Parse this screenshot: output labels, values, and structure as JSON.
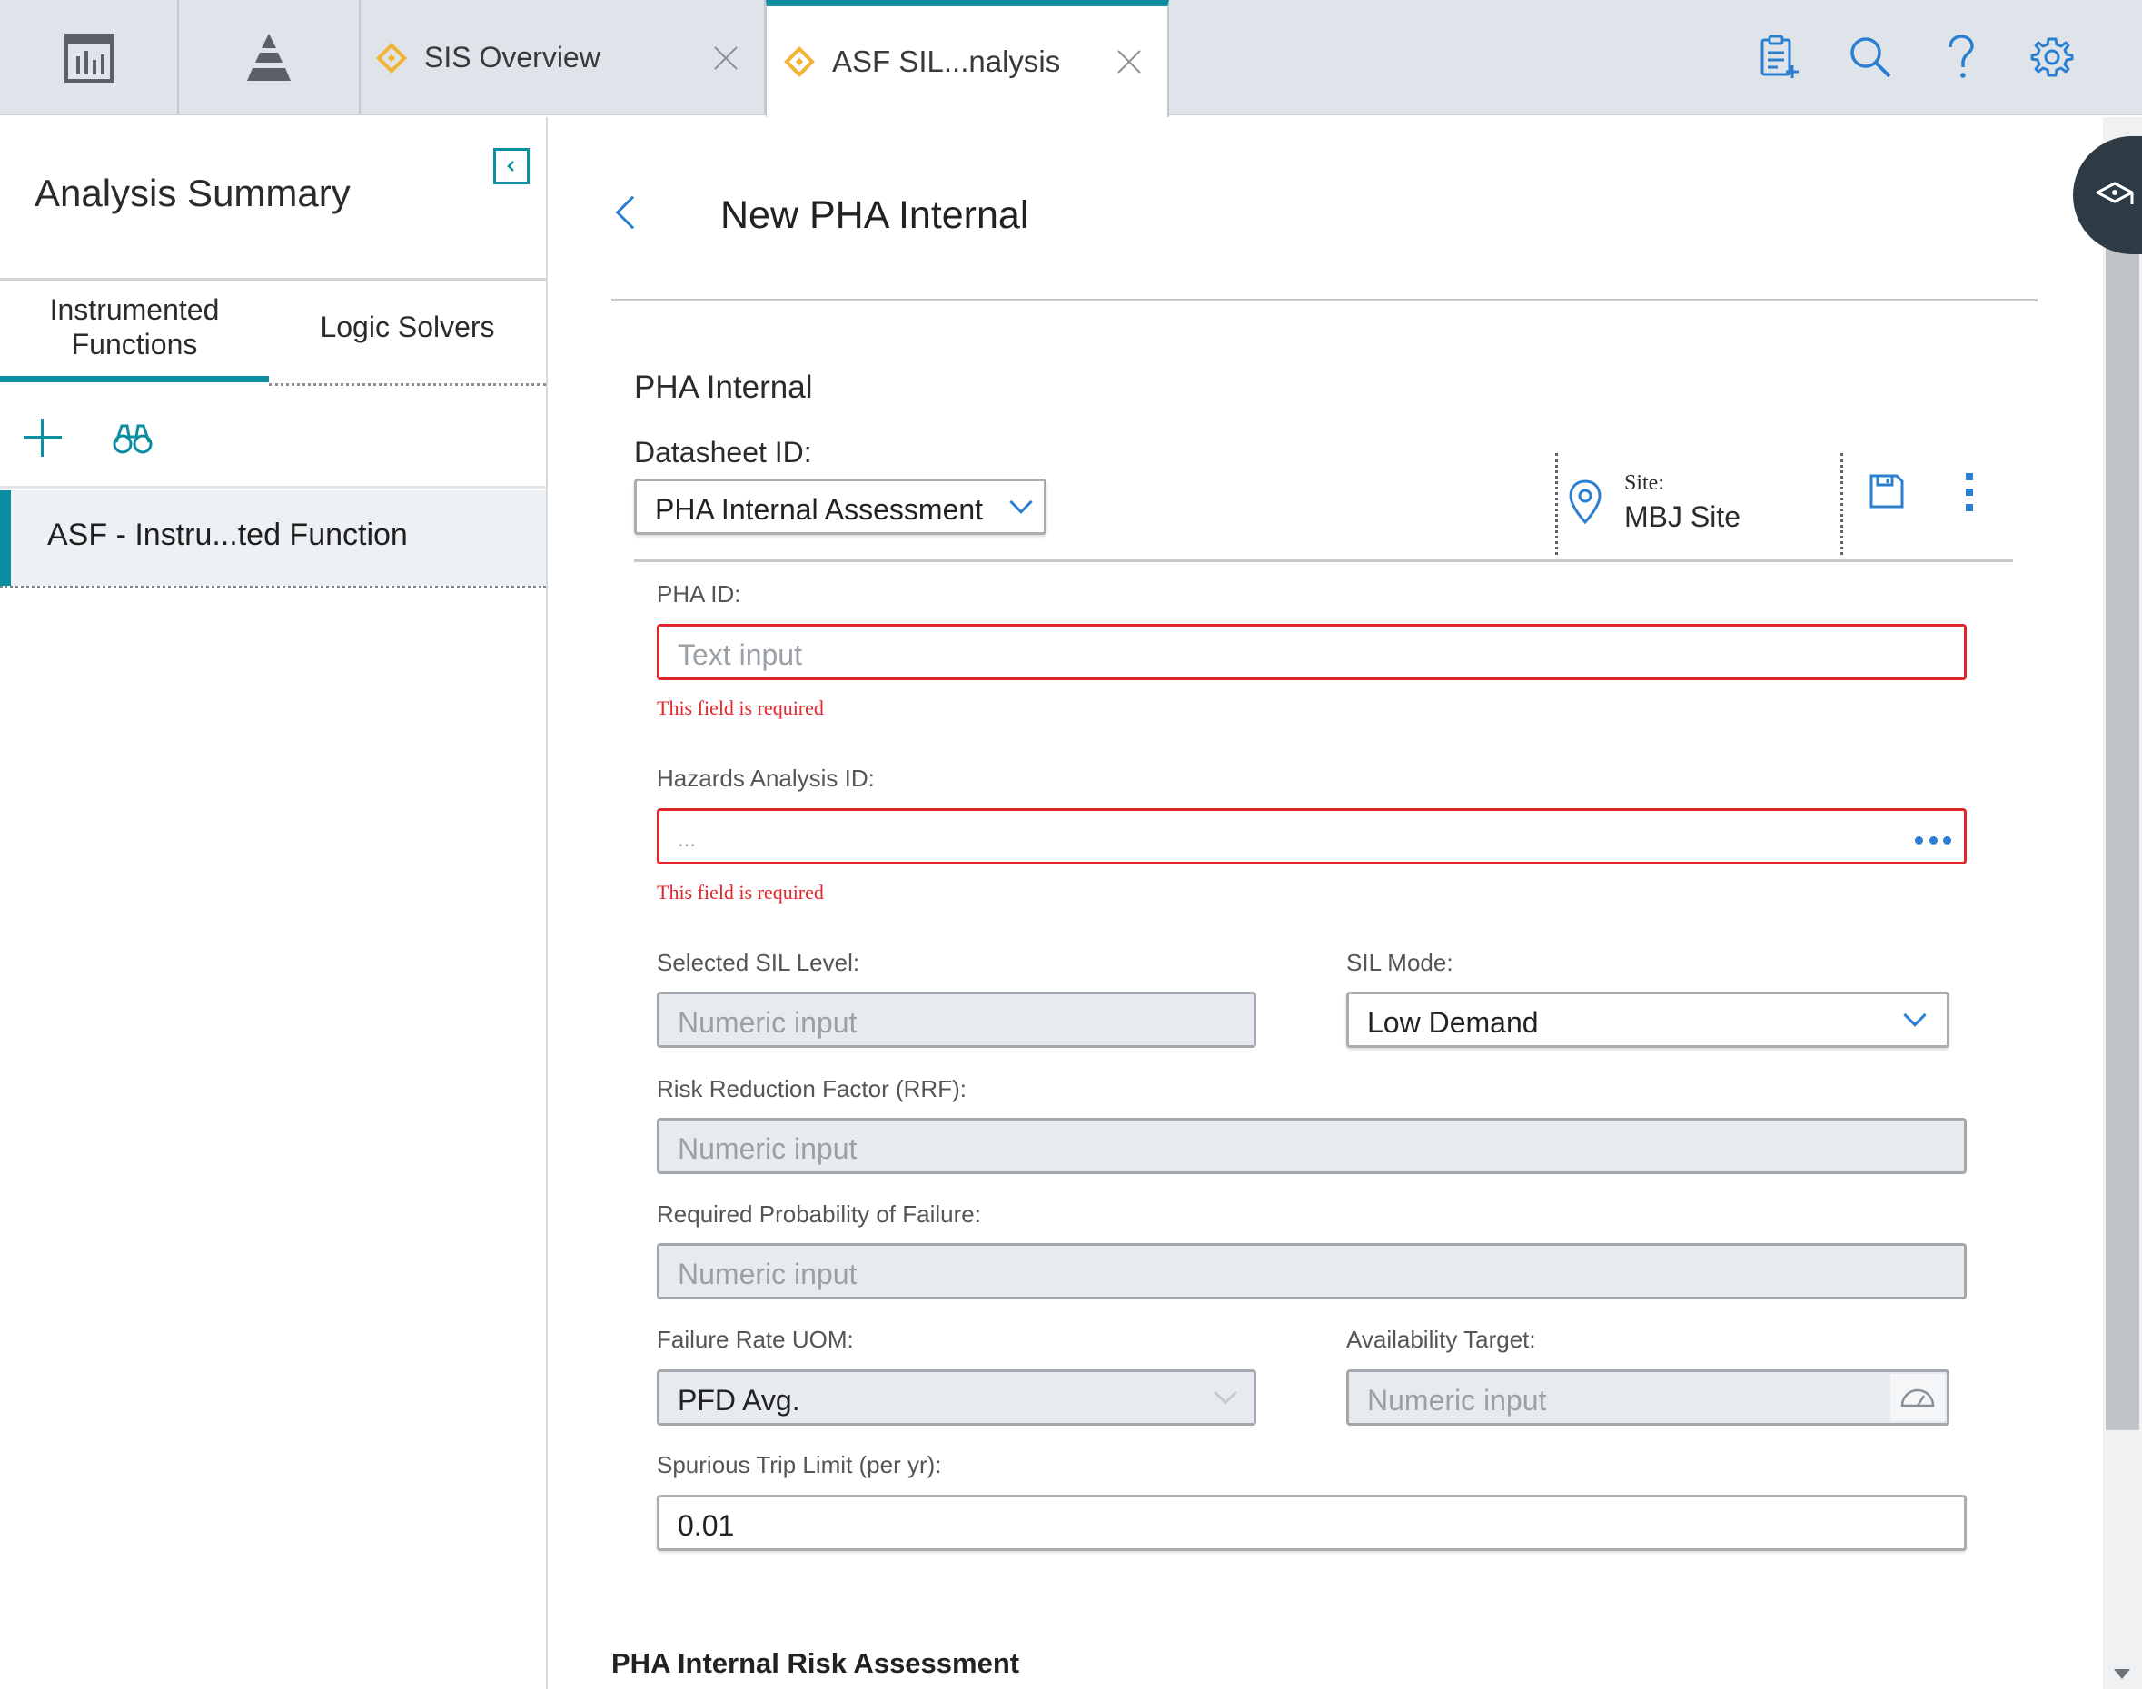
{
  "topbar": {
    "tabs": [
      {
        "label": "SIS Overview",
        "active": false
      },
      {
        "label": "ASF SIL...nalysis",
        "active": true
      }
    ],
    "icons": [
      "dashboard-icon",
      "pyramid-icon",
      "checklist-add-icon",
      "search-icon",
      "help-icon",
      "gear-icon"
    ],
    "accent": "#0b8ea0",
    "tab_icon_color": "#f2b233"
  },
  "sidebar": {
    "title": "Analysis Summary",
    "tabs": [
      {
        "label": "Instrumented Functions",
        "active": true
      },
      {
        "label": "Logic Solvers",
        "active": false
      }
    ],
    "items": [
      {
        "label": "ASF - Instru...ted Function",
        "selected": true
      }
    ]
  },
  "main": {
    "title": "New PHA Internal",
    "section_title": "PHA Internal",
    "datasheet": {
      "label": "Datasheet ID:",
      "value": "PHA Internal Assessment"
    },
    "site": {
      "label": "Site:",
      "value": "MBJ Site"
    },
    "fields": {
      "pha_id": {
        "label": "PHA ID:",
        "placeholder": "Text input",
        "error": "This field is required"
      },
      "hazards_analysis_id": {
        "label": "Hazards Analysis ID:",
        "placeholder": "...",
        "error": "This field is required"
      },
      "selected_sil_level": {
        "label": "Selected SIL Level:",
        "placeholder": "Numeric input"
      },
      "sil_mode": {
        "label": "SIL Mode:",
        "value": "Low Demand"
      },
      "rrf": {
        "label": "Risk Reduction Factor (RRF):",
        "placeholder": "Numeric input"
      },
      "required_pof": {
        "label": "Required Probability of Failure:",
        "placeholder": "Numeric input"
      },
      "failure_rate_uom": {
        "label": "Failure Rate UOM:",
        "value": "PFD Avg."
      },
      "availability_target": {
        "label": "Availability Target:",
        "placeholder": "Numeric input"
      },
      "spurious_trip_limit": {
        "label": "Spurious Trip Limit (per yr):",
        "value": "0.01"
      }
    },
    "bottom_heading": "PHA Internal Risk Assessment",
    "error_color": "#e2272b",
    "link_color": "#2b7fd0"
  }
}
